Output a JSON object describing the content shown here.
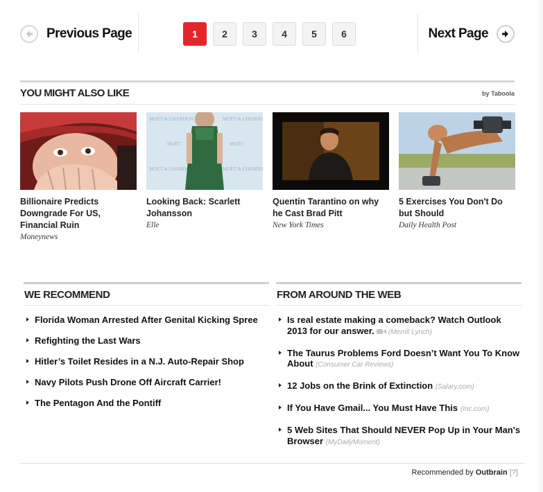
{
  "pagination": {
    "prev_label": "Previous Page",
    "next_label": "Next Page",
    "pages": [
      "1",
      "2",
      "3",
      "4",
      "5",
      "6"
    ],
    "active_page": "1",
    "active_color": "#e4262b"
  },
  "ymal": {
    "title": "YOU MIGHT ALSO LIKE",
    "by": "by Taboola",
    "cards": [
      {
        "title": "Billionaire Predicts Downgrade For US, Financial Ruin",
        "source": "Moneynews",
        "image": "elderly-man-photo"
      },
      {
        "title": "Looking Back: Scarlett Johansson",
        "source": "Elle",
        "image": "green-dress-red-carpet-photo"
      },
      {
        "title": "Quentin Tarantino on why he Cast Brad Pitt",
        "source": "New York Times",
        "image": "video-still-photo"
      },
      {
        "title": "5 Exercises You Don't Do but Should",
        "source": "Daily Health Post",
        "image": "dumbbell-exercise-photo"
      }
    ]
  },
  "we_recommend": {
    "title": "WE RECOMMEND",
    "items": [
      "Florida Woman Arrested After Genital Kicking Spree",
      "Refighting the Last Wars",
      "Hitler’s Toilet Resides in a N.J. Auto-Repair Shop",
      "Navy Pilots Push Drone Off Aircraft Carrier!",
      "The Pentagon And the Pontiff"
    ]
  },
  "around_web": {
    "title": "FROM AROUND THE WEB",
    "items": [
      {
        "text": "Is real estate making a comeback? Watch Outlook 2013 for our answer.",
        "source": "(Merrill Lynch)",
        "icon": "video-camera-icon"
      },
      {
        "text": "The Taurus Problems Ford Doesn’t Want You To Know About",
        "source": "(Consumer Car Reviews)"
      },
      {
        "text": "12 Jobs on the Brink of Extinction",
        "source": "(Salary.com)"
      },
      {
        "text": "If You Have Gmail... You Must Have This",
        "source": "(Inc.com)"
      },
      {
        "text": "5 Web Sites That Should NEVER Pop Up in Your Man's Browser",
        "source": "(MyDailyMoment)"
      }
    ]
  },
  "footer": {
    "prefix": "Recommended by",
    "brand": "Outbrain",
    "help": "[?]"
  }
}
